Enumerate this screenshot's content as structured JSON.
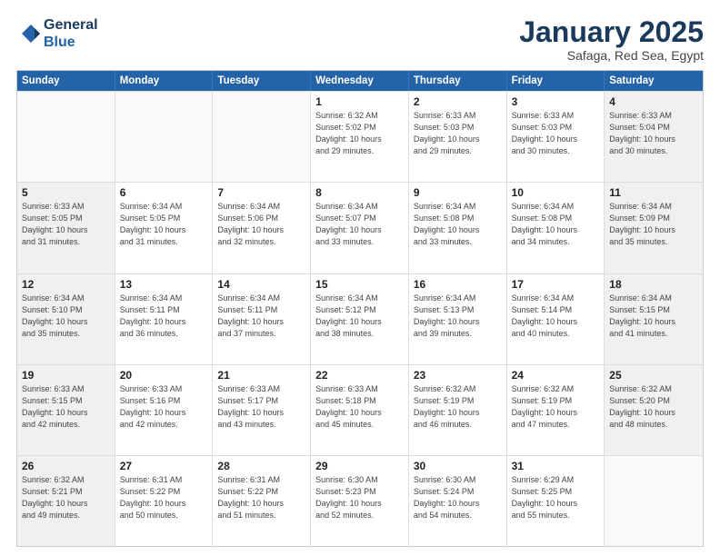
{
  "logo": {
    "line1": "General",
    "line2": "Blue"
  },
  "title": "January 2025",
  "subtitle": "Safaga, Red Sea, Egypt",
  "days_of_week": [
    "Sunday",
    "Monday",
    "Tuesday",
    "Wednesday",
    "Thursday",
    "Friday",
    "Saturday"
  ],
  "weeks": [
    [
      {
        "day": "",
        "info": ""
      },
      {
        "day": "",
        "info": ""
      },
      {
        "day": "",
        "info": ""
      },
      {
        "day": "1",
        "info": "Sunrise: 6:32 AM\nSunset: 5:02 PM\nDaylight: 10 hours\nand 29 minutes."
      },
      {
        "day": "2",
        "info": "Sunrise: 6:33 AM\nSunset: 5:03 PM\nDaylight: 10 hours\nand 29 minutes."
      },
      {
        "day": "3",
        "info": "Sunrise: 6:33 AM\nSunset: 5:03 PM\nDaylight: 10 hours\nand 30 minutes."
      },
      {
        "day": "4",
        "info": "Sunrise: 6:33 AM\nSunset: 5:04 PM\nDaylight: 10 hours\nand 30 minutes."
      }
    ],
    [
      {
        "day": "5",
        "info": "Sunrise: 6:33 AM\nSunset: 5:05 PM\nDaylight: 10 hours\nand 31 minutes."
      },
      {
        "day": "6",
        "info": "Sunrise: 6:34 AM\nSunset: 5:05 PM\nDaylight: 10 hours\nand 31 minutes."
      },
      {
        "day": "7",
        "info": "Sunrise: 6:34 AM\nSunset: 5:06 PM\nDaylight: 10 hours\nand 32 minutes."
      },
      {
        "day": "8",
        "info": "Sunrise: 6:34 AM\nSunset: 5:07 PM\nDaylight: 10 hours\nand 33 minutes."
      },
      {
        "day": "9",
        "info": "Sunrise: 6:34 AM\nSunset: 5:08 PM\nDaylight: 10 hours\nand 33 minutes."
      },
      {
        "day": "10",
        "info": "Sunrise: 6:34 AM\nSunset: 5:08 PM\nDaylight: 10 hours\nand 34 minutes."
      },
      {
        "day": "11",
        "info": "Sunrise: 6:34 AM\nSunset: 5:09 PM\nDaylight: 10 hours\nand 35 minutes."
      }
    ],
    [
      {
        "day": "12",
        "info": "Sunrise: 6:34 AM\nSunset: 5:10 PM\nDaylight: 10 hours\nand 35 minutes."
      },
      {
        "day": "13",
        "info": "Sunrise: 6:34 AM\nSunset: 5:11 PM\nDaylight: 10 hours\nand 36 minutes."
      },
      {
        "day": "14",
        "info": "Sunrise: 6:34 AM\nSunset: 5:11 PM\nDaylight: 10 hours\nand 37 minutes."
      },
      {
        "day": "15",
        "info": "Sunrise: 6:34 AM\nSunset: 5:12 PM\nDaylight: 10 hours\nand 38 minutes."
      },
      {
        "day": "16",
        "info": "Sunrise: 6:34 AM\nSunset: 5:13 PM\nDaylight: 10 hours\nand 39 minutes."
      },
      {
        "day": "17",
        "info": "Sunrise: 6:34 AM\nSunset: 5:14 PM\nDaylight: 10 hours\nand 40 minutes."
      },
      {
        "day": "18",
        "info": "Sunrise: 6:34 AM\nSunset: 5:15 PM\nDaylight: 10 hours\nand 41 minutes."
      }
    ],
    [
      {
        "day": "19",
        "info": "Sunrise: 6:33 AM\nSunset: 5:15 PM\nDaylight: 10 hours\nand 42 minutes."
      },
      {
        "day": "20",
        "info": "Sunrise: 6:33 AM\nSunset: 5:16 PM\nDaylight: 10 hours\nand 42 minutes."
      },
      {
        "day": "21",
        "info": "Sunrise: 6:33 AM\nSunset: 5:17 PM\nDaylight: 10 hours\nand 43 minutes."
      },
      {
        "day": "22",
        "info": "Sunrise: 6:33 AM\nSunset: 5:18 PM\nDaylight: 10 hours\nand 45 minutes."
      },
      {
        "day": "23",
        "info": "Sunrise: 6:32 AM\nSunset: 5:19 PM\nDaylight: 10 hours\nand 46 minutes."
      },
      {
        "day": "24",
        "info": "Sunrise: 6:32 AM\nSunset: 5:19 PM\nDaylight: 10 hours\nand 47 minutes."
      },
      {
        "day": "25",
        "info": "Sunrise: 6:32 AM\nSunset: 5:20 PM\nDaylight: 10 hours\nand 48 minutes."
      }
    ],
    [
      {
        "day": "26",
        "info": "Sunrise: 6:32 AM\nSunset: 5:21 PM\nDaylight: 10 hours\nand 49 minutes."
      },
      {
        "day": "27",
        "info": "Sunrise: 6:31 AM\nSunset: 5:22 PM\nDaylight: 10 hours\nand 50 minutes."
      },
      {
        "day": "28",
        "info": "Sunrise: 6:31 AM\nSunset: 5:22 PM\nDaylight: 10 hours\nand 51 minutes."
      },
      {
        "day": "29",
        "info": "Sunrise: 6:30 AM\nSunset: 5:23 PM\nDaylight: 10 hours\nand 52 minutes."
      },
      {
        "day": "30",
        "info": "Sunrise: 6:30 AM\nSunset: 5:24 PM\nDaylight: 10 hours\nand 54 minutes."
      },
      {
        "day": "31",
        "info": "Sunrise: 6:29 AM\nSunset: 5:25 PM\nDaylight: 10 hours\nand 55 minutes."
      },
      {
        "day": "",
        "info": ""
      }
    ]
  ]
}
